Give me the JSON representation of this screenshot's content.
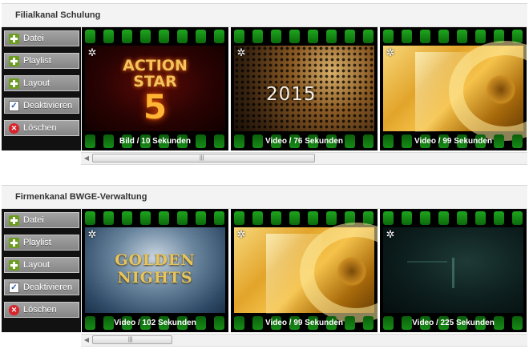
{
  "panels": [
    {
      "title": "Filialkanal Schulung",
      "buttons": [
        {
          "label": "Datei",
          "icon": "plus-icon"
        },
        {
          "label": "Playlist",
          "icon": "plus-icon"
        },
        {
          "label": "Layout",
          "icon": "plus-icon"
        },
        {
          "label": "Deaktivieren",
          "icon": "checkbox-icon"
        },
        {
          "label": "Löschen",
          "icon": "remove-icon"
        }
      ],
      "tiles": [
        {
          "label": "Bild / 10 Sekunden",
          "thumb_line1": "ACTION",
          "thumb_line2": "STAR",
          "thumb_line3": "5"
        },
        {
          "label": "Video / 76 Sekunden",
          "thumb_text": "2015"
        },
        {
          "label": "Video / 99 Sekunden"
        }
      ]
    },
    {
      "title": "Firmenkanal BWGE-Verwaltung",
      "buttons": [
        {
          "label": "Datei",
          "icon": "plus-icon"
        },
        {
          "label": "Playlist",
          "icon": "plus-icon"
        },
        {
          "label": "Layout",
          "icon": "plus-icon"
        },
        {
          "label": "Deaktivieren",
          "icon": "checkbox-icon"
        },
        {
          "label": "Löschen",
          "icon": "remove-icon"
        }
      ],
      "tiles": [
        {
          "label": "Video / 102 Sekunden",
          "thumb_line1": "GOLDEN",
          "thumb_line2": "NIGHTS"
        },
        {
          "label": "Video / 99 Sekunden"
        },
        {
          "label": "Video / 225 Sekunden"
        }
      ]
    }
  ],
  "icons": {
    "gear": "gear-icon",
    "scroll_left": "arrow-left-icon",
    "scroll_right": "arrow-right-icon",
    "scroll_grip": "grip-icon"
  },
  "colors": {
    "film_hole": "#1ea51e",
    "button_bg": "#959595",
    "plus": "#6c9e1e",
    "remove": "#d9232a"
  }
}
